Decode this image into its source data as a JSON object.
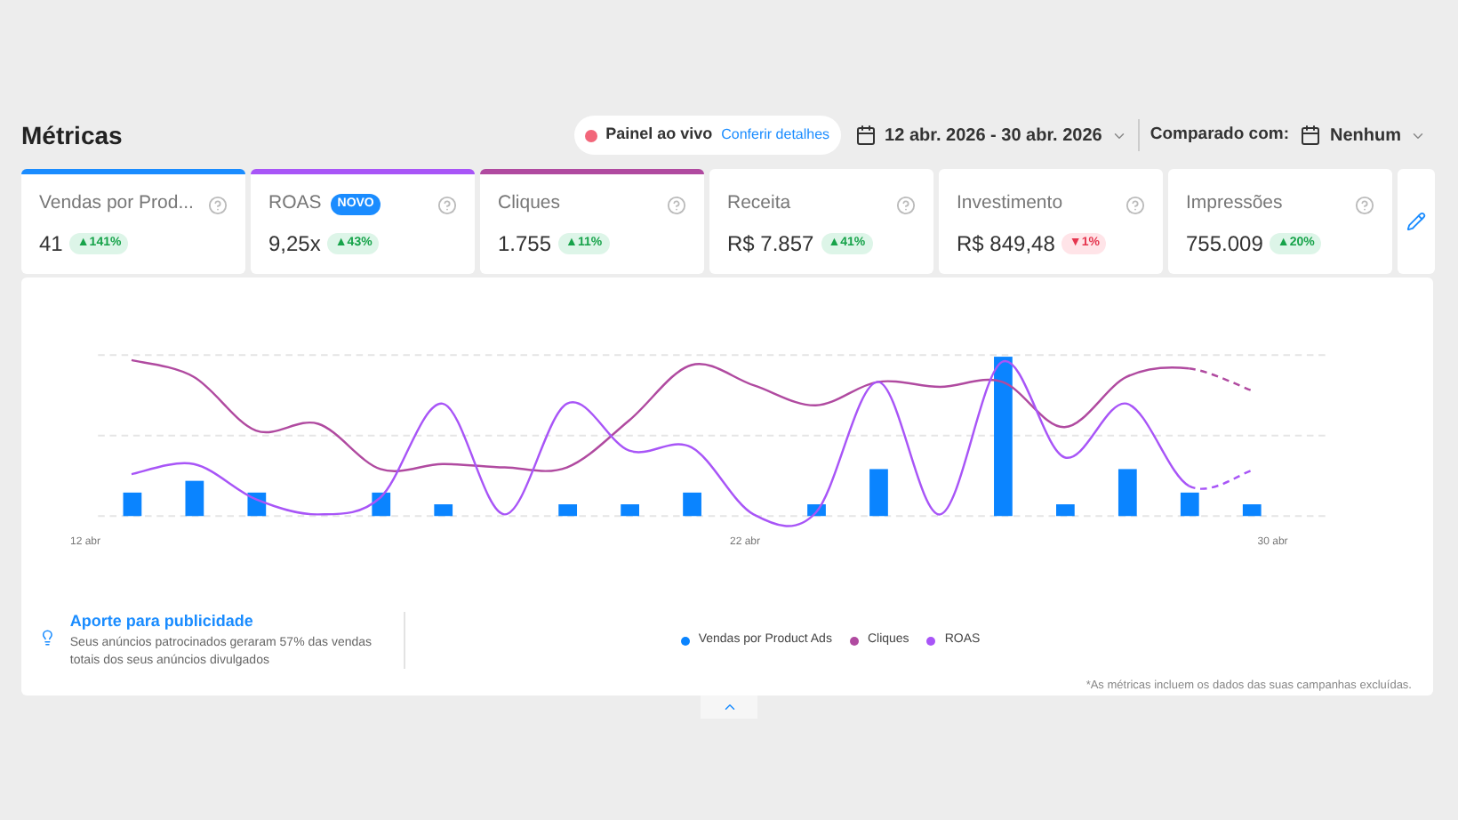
{
  "title": "Métricas",
  "live_panel": {
    "label": "Painel ao vivo",
    "link": "Conferir detalhes"
  },
  "date_range": "12 abr. 2026 - 30 abr. 2026",
  "compare": {
    "label": "Comparado com:",
    "value": "Nenhum"
  },
  "metrics": [
    {
      "label": "Vendas por Prod...",
      "value": "41",
      "arrow": "▲",
      "change": "141%",
      "negative": false,
      "selected": true,
      "color": "#1a8cff"
    },
    {
      "label": "ROAS",
      "badge": "NOVO",
      "value": "9,25x",
      "arrow": "▲",
      "change": "43%",
      "negative": false,
      "selected": true,
      "color": "#a855f7"
    },
    {
      "label": "Cliques",
      "value": "1.755",
      "arrow": "▲",
      "change": "11%",
      "negative": false,
      "selected": true,
      "color": "#b04aa0"
    },
    {
      "label": "Receita",
      "value": "R$ 7.857",
      "arrow": "▲",
      "change": "41%",
      "negative": false,
      "selected": false
    },
    {
      "label": "Investimento",
      "value": "R$ 849,48",
      "arrow": "▼",
      "change": "1%",
      "negative": true,
      "selected": false
    },
    {
      "label": "Impressões",
      "value": "755.009",
      "arrow": "▲",
      "change": "20%",
      "negative": false,
      "selected": false
    }
  ],
  "chart": {
    "x_labels": [
      "12 abr",
      "22 abr",
      "30 abr"
    ],
    "legend": [
      {
        "label": "Vendas por Product Ads",
        "color": "#0a84ff"
      },
      {
        "label": "Cliques",
        "color": "#b04aa0"
      },
      {
        "label": "ROAS",
        "color": "#a855f7"
      }
    ]
  },
  "insight": {
    "title": "Aporte para publicidade",
    "text": "Seus anúncios patrocinados geraram 57% das vendas totais dos seus anúncios divulgados"
  },
  "footnote": "*As métricas incluem os dados das suas campanhas excluídas."
}
